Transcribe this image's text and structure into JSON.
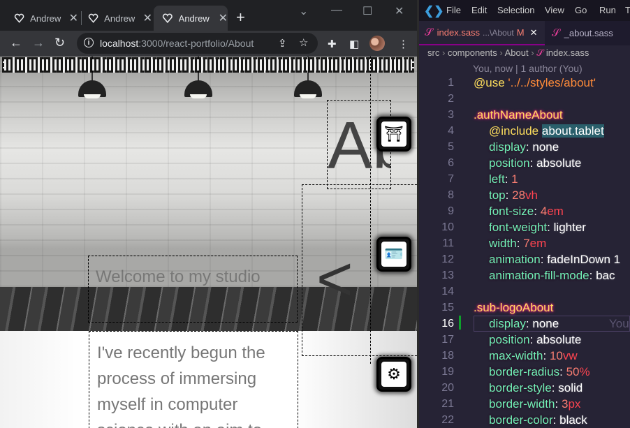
{
  "browser": {
    "tabs": [
      {
        "title": "Andrew",
        "active": false
      },
      {
        "title": "Andrew",
        "active": false
      },
      {
        "title": "Andrew",
        "active": true
      }
    ],
    "url_host": "localhost",
    "url_rest": ":3000/react-portfolio/About",
    "page": {
      "welcome_text": "Welcome to my studio",
      "intro_text": "I've recently begun the process of immersing myself in computer science with an aim to",
      "big_heading": "Ab",
      "arrow_glyph": "<"
    }
  },
  "vscode": {
    "menu": [
      "File",
      "Edit",
      "Selection",
      "View",
      "Go",
      "Run",
      "Te"
    ],
    "tabs": [
      {
        "label": "index.sass",
        "suffix": "...\\About",
        "status": "M",
        "active": true
      },
      {
        "label": "_about.sass",
        "active": false
      }
    ],
    "breadcrumb": [
      "src",
      "components",
      "About",
      "index.sass"
    ],
    "blame": "You, now | 1 author (You)",
    "current_line": 16,
    "inline_hint": "You",
    "lines": [
      {
        "n": "1",
        "t": "@use '../../styles/about'"
      },
      {
        "n": "2",
        "t": ""
      },
      {
        "n": "3",
        "t": ".authNameAbout"
      },
      {
        "n": "4",
        "t": "@include about.tablet"
      },
      {
        "n": "5",
        "t": "display: none"
      },
      {
        "n": "6",
        "t": "position: absolute"
      },
      {
        "n": "7",
        "t": "left: 1"
      },
      {
        "n": "8",
        "t": "top: 28vh"
      },
      {
        "n": "9",
        "t": "font-size: 4em"
      },
      {
        "n": "10",
        "t": "font-weight: lighter"
      },
      {
        "n": "11",
        "t": "width: 7em"
      },
      {
        "n": "12",
        "t": "animation: fadeInDown 1"
      },
      {
        "n": "13",
        "t": "animation-fill-mode: bac"
      },
      {
        "n": "14",
        "t": ""
      },
      {
        "n": "15",
        "t": ".sub-logoAbout"
      },
      {
        "n": "16",
        "t": "display: none"
      },
      {
        "n": "17",
        "t": "position: absolute"
      },
      {
        "n": "18",
        "t": "max-width: 10vw"
      },
      {
        "n": "19",
        "t": "border-radius: 50%"
      },
      {
        "n": "20",
        "t": "border-style: solid"
      },
      {
        "n": "21",
        "t": "border-width: 3px"
      },
      {
        "n": "22",
        "t": "border-color: black"
      }
    ]
  },
  "colors": {
    "vscode_bg": "#262335",
    "selector": "#fede5d",
    "property": "#72f1b8",
    "number": "#f97e72",
    "string": "#ff8b39",
    "accent_pink": "#f33f9f"
  }
}
